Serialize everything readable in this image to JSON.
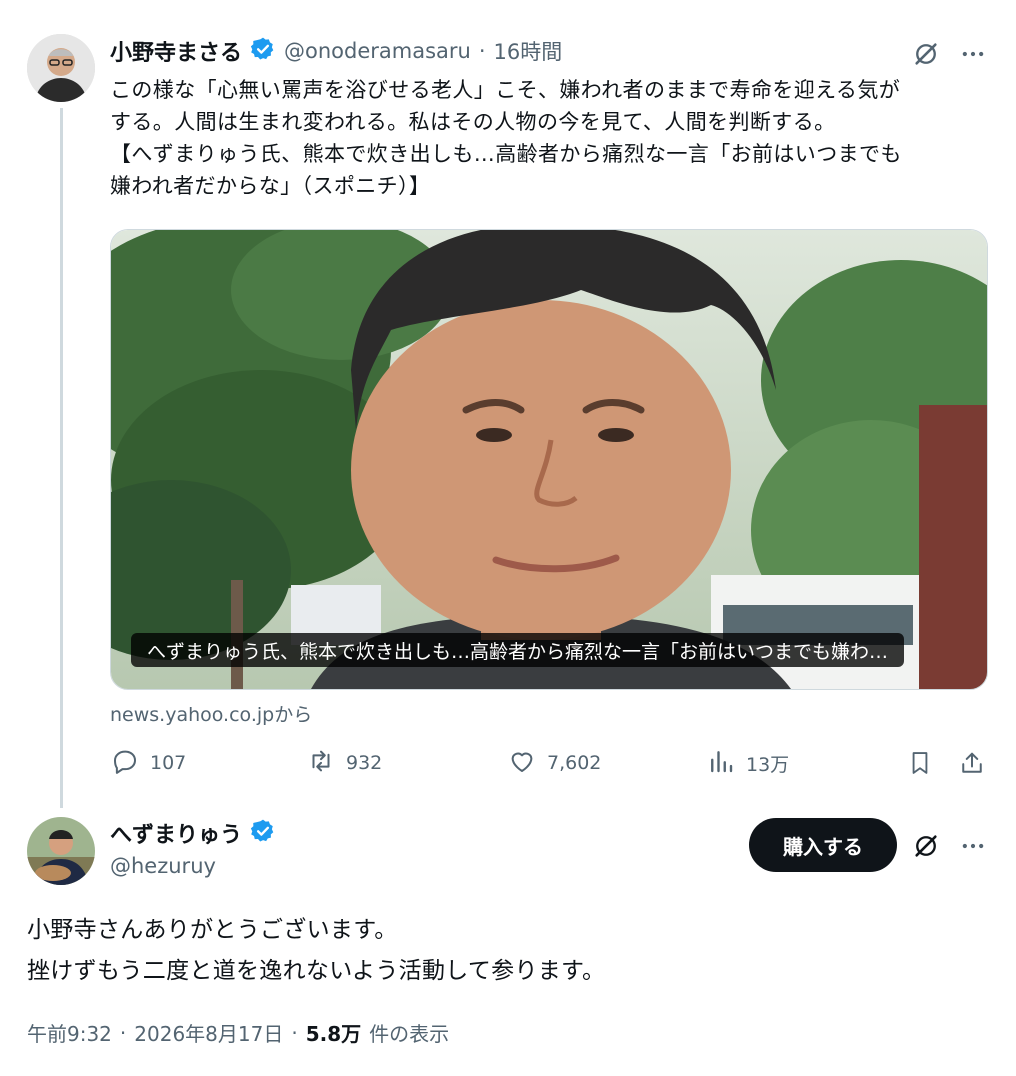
{
  "tweet": {
    "author_name": "小野寺まさる",
    "handle": "@onoderamasaru",
    "separator": "·",
    "time": "16時間",
    "text_lines": [
      "この様な「心無い罵声を浴びせる老人」こそ、嫌われ者のままで寿命を迎える気が",
      "する。人間は生まれ変われる。私はその人物の今を見て、人間を判断する。",
      "【へずまりゅう氏、熊本で炊き出しも…高齢者から痛烈な一言「お前はいつまでも",
      "嫌われ者だからな」（スポニチ）】"
    ],
    "card": {
      "caption": "へずまりゅう氏、熊本で炊き出しも…高齢者から痛烈な一言「お前はいつまでも嫌わ…",
      "source": "news.yahoo.co.jpから"
    },
    "stats": {
      "replies": "107",
      "reposts": "932",
      "likes": "7,602",
      "views": "13万"
    }
  },
  "reply": {
    "author_name": "へずまりゅう",
    "handle": "@hezuruy",
    "buy_label": "購入する",
    "text_lines": [
      "小野寺さんありがとうございます。",
      "挫けずもう二度と道を逸れないよう活動して参ります。"
    ],
    "time": "午前9:32",
    "date": "2026年8月17日",
    "separator": "·",
    "views_count": "5.8万",
    "views_label": "件の表示"
  },
  "colors": {
    "verified": "#1d9bf0",
    "muted": "#536471",
    "thread_line": "#cfd9de"
  },
  "icons": [
    "verified-badge-icon",
    "grok-icon",
    "more-icon",
    "reply-icon",
    "repost-icon",
    "like-icon",
    "views-icon",
    "bookmark-icon",
    "share-icon"
  ]
}
